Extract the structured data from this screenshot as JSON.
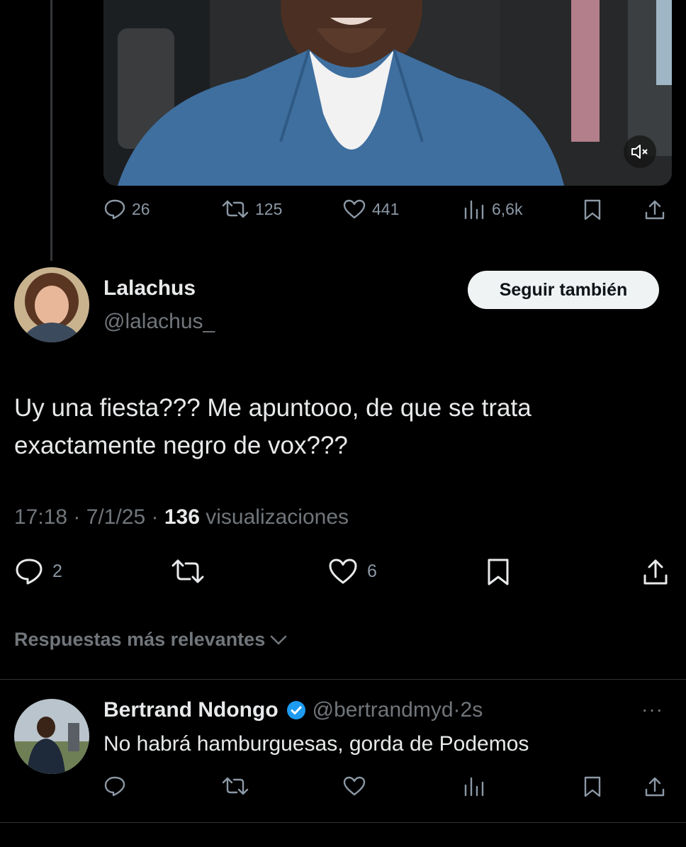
{
  "thread": {
    "media": {
      "mute_icon": "volume-mute-icon"
    },
    "stats": {
      "replies": "26",
      "retweets": "125",
      "likes": "441",
      "views": "6,6k"
    }
  },
  "tweet": {
    "author_name": "Lalachus",
    "author_handle": "@lalachus_",
    "follow_label": "Seguir también",
    "text_line1": "Uy una fiesta??? Me apuntooo, de que se trata",
    "text_line2": "exactamente negro de vox???",
    "time": "17:18",
    "date": "7/1/25",
    "views_count": "136",
    "views_label": "visualizaciones",
    "replies": "2",
    "likes": "6"
  },
  "replies_sort": {
    "label": "Respuestas más relevantes"
  },
  "reply": {
    "author_name": "Bertrand Ndongo",
    "author_handle": "@bertrandmyd",
    "age": "2s",
    "text": "No habrá hamburguesas, gorda de Podemos",
    "more_label": "···"
  },
  "colors": {
    "background": "#000000",
    "text": "#e7e9ea",
    "muted": "#71767b",
    "verified": "#1d9bf0",
    "button_bg": "#eff3f4"
  }
}
